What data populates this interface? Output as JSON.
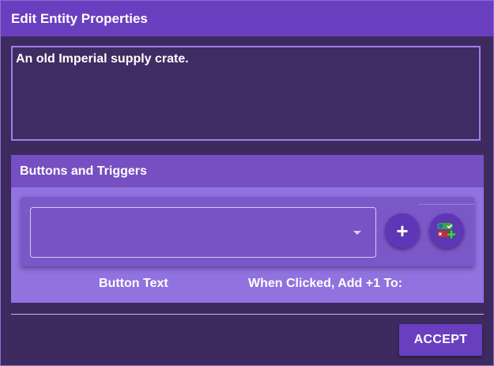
{
  "dialog": {
    "title": "Edit Entity Properties",
    "description": "An old Imperial supply crate.",
    "section_title": "Buttons and Triggers",
    "select": {
      "value": ""
    },
    "add_button_label": "+",
    "columns": {
      "button_text": "Button Text",
      "when_clicked": "When Clicked, Add +1 To:"
    },
    "accept_label": "ACCEPT"
  },
  "icons": {
    "dropdown": "caret-down-icon",
    "trigger_toggles": "toggle-add-icon"
  },
  "colors": {
    "titlebar": "#6a3fbf",
    "background": "#3d2b5f",
    "section_header": "#764fc2",
    "section_body": "#9172de",
    "card": "#7b58c8",
    "toggle_green": "#3aa845",
    "toggle_red": "#c0303a"
  }
}
